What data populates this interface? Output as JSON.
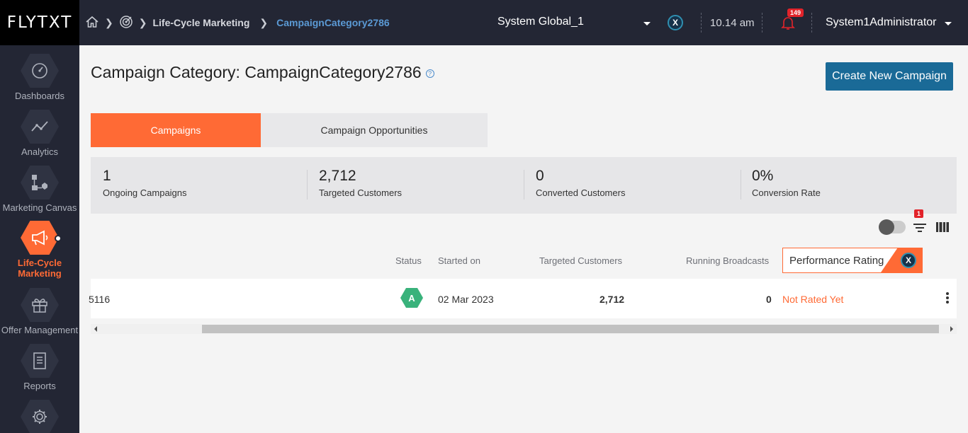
{
  "app": {
    "logo": "FLYTXT"
  },
  "breadcrumb": {
    "items": [
      "Life-Cycle Marketing",
      "CampaignCategory2786"
    ]
  },
  "header": {
    "org": "System Global_1",
    "time": "10.14 am",
    "notification_count": "149",
    "user": "System1Administrator"
  },
  "sidebar": {
    "items": [
      {
        "label": "Dashboards",
        "icon": "gauge-icon"
      },
      {
        "label": "Analytics",
        "icon": "line-chart-icon"
      },
      {
        "label": "Marketing Canvas",
        "icon": "flow-icon"
      },
      {
        "label": "Life-Cycle Marketing",
        "icon": "megaphone-icon",
        "active": true
      },
      {
        "label": "Offer Management",
        "icon": "gift-icon"
      },
      {
        "label": "Reports",
        "icon": "report-icon"
      },
      {
        "label": "",
        "icon": "gear-icon"
      }
    ]
  },
  "page": {
    "title": "Campaign Category: CampaignCategory2786",
    "create_button": "Create New Campaign"
  },
  "tabs": [
    {
      "label": "Campaigns",
      "active": true
    },
    {
      "label": "Campaign Opportunities",
      "active": false
    }
  ],
  "stats": [
    {
      "value": "1",
      "label": "Ongoing Campaigns"
    },
    {
      "value": "2,712",
      "label": "Targeted Customers"
    },
    {
      "value": "0",
      "label": "Converted Customers"
    },
    {
      "value": "0%",
      "label": "Conversion Rate"
    }
  ],
  "filter_badge": "1",
  "table": {
    "headers": {
      "status": "Status",
      "started_on": "Started on",
      "targeted": "Targeted Customers",
      "running": "Running Broadcasts",
      "performance": "Performance Rating"
    },
    "rows": [
      {
        "name_fragment": "5116",
        "status": "A",
        "started_on": "02 Mar 2023",
        "targeted": "2,712",
        "running": "0",
        "performance": "Not Rated Yet"
      }
    ]
  },
  "colors": {
    "accent": "#ff6a35",
    "primary_button": "#1a6a97",
    "topbar": "#232634",
    "status_active": "#39b27b"
  }
}
